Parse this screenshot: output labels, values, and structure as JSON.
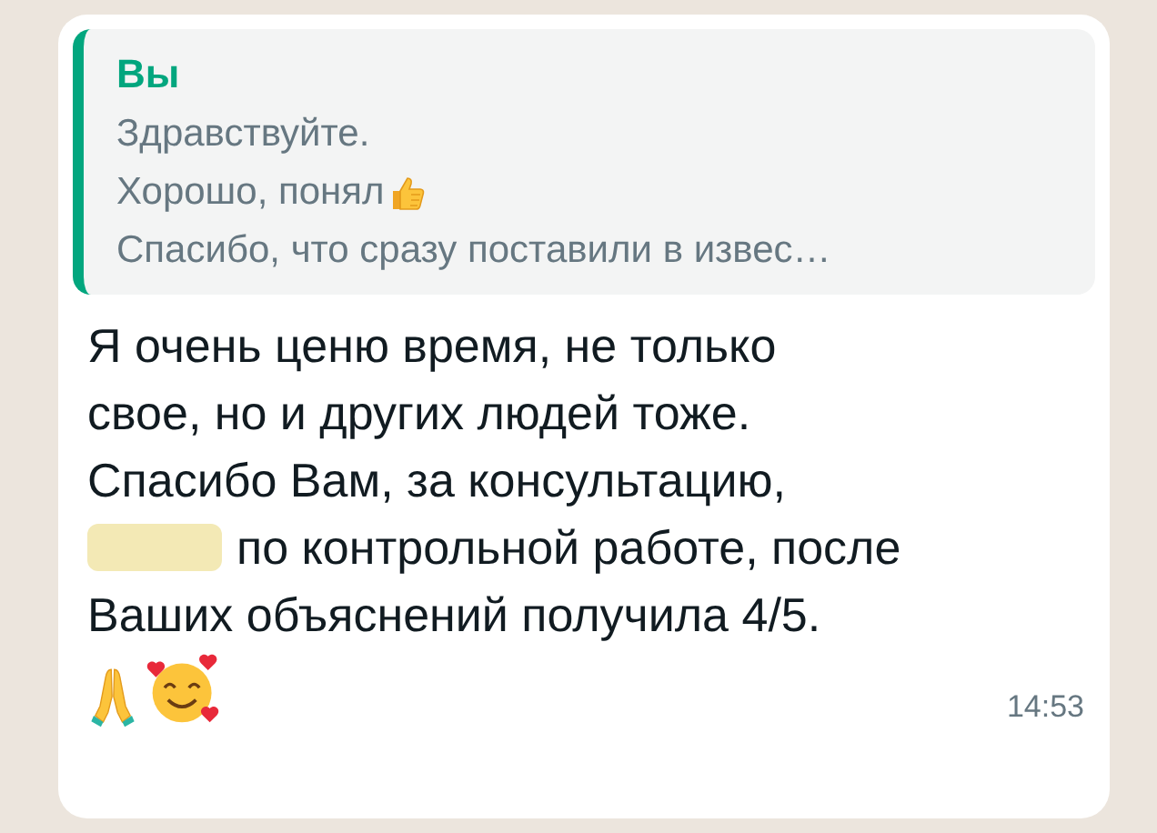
{
  "quote": {
    "author": "Вы",
    "lines": [
      "Здравствуйте.",
      "Хорошо, понял",
      "Спасибо, что сразу поставили в извес…"
    ]
  },
  "message": {
    "text_before": "Я очень ценю время, не только\nсвое, но и других людей тоже.\nСпасибо Вам, за консультацию,",
    "redacted": true,
    "text_after": "по контрольной работе, после\nВаших объяснений получила 4/5.",
    "time": "14:53"
  }
}
